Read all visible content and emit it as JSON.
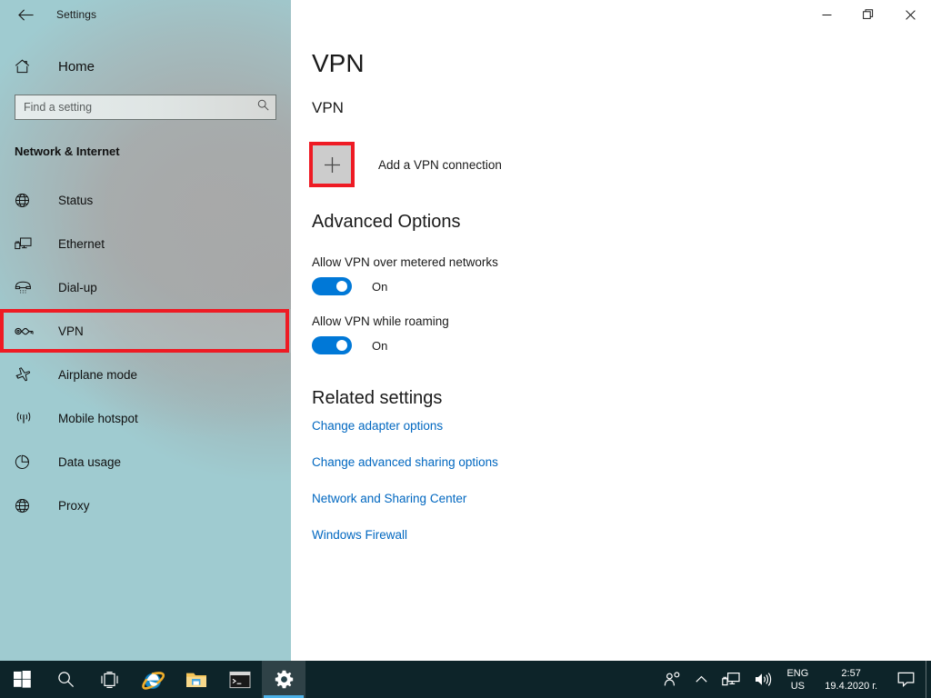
{
  "window": {
    "app_title": "Settings",
    "back_icon": "back-arrow-icon",
    "controls": {
      "minimize": "minimize-icon",
      "maximize": "restore-icon",
      "close": "close-icon"
    }
  },
  "sidebar": {
    "home": {
      "label": "Home",
      "icon": "home-icon"
    },
    "search": {
      "placeholder": "Find a setting",
      "value": "",
      "icon": "search-icon"
    },
    "category": "Network & Internet",
    "selected_index": 3,
    "items": [
      {
        "label": "Status",
        "icon": "status-globe-icon"
      },
      {
        "label": "Ethernet",
        "icon": "ethernet-icon"
      },
      {
        "label": "Dial-up",
        "icon": "dialup-phone-icon"
      },
      {
        "label": "VPN",
        "icon": "vpn-key-icon"
      },
      {
        "label": "Airplane mode",
        "icon": "airplane-icon"
      },
      {
        "label": "Mobile hotspot",
        "icon": "hotspot-icon"
      },
      {
        "label": "Data usage",
        "icon": "pie-chart-icon"
      },
      {
        "label": "Proxy",
        "icon": "globe-icon"
      }
    ]
  },
  "main": {
    "page_title": "VPN",
    "vpn_section": {
      "heading": "VPN",
      "add_button_icon": "plus-icon",
      "add_button_label": "Add a VPN connection"
    },
    "advanced": {
      "heading": "Advanced Options",
      "toggles": [
        {
          "label": "Allow VPN over metered networks",
          "state": "On",
          "on": true
        },
        {
          "label": "Allow VPN while roaming",
          "state": "On",
          "on": true
        }
      ]
    },
    "related": {
      "heading": "Related settings",
      "links": [
        "Change adapter options",
        "Change advanced sharing options",
        "Network and Sharing Center",
        "Windows Firewall"
      ]
    }
  },
  "taskbar": {
    "buttons": [
      {
        "name": "start-button",
        "icon": "windows-logo-icon"
      },
      {
        "name": "search-button",
        "icon": "search-icon"
      },
      {
        "name": "task-view-button",
        "icon": "task-view-icon"
      },
      {
        "name": "internet-explorer-button",
        "icon": "internet-explorer-icon"
      },
      {
        "name": "file-explorer-button",
        "icon": "folder-icon"
      },
      {
        "name": "command-prompt-button",
        "icon": "command-prompt-icon"
      },
      {
        "name": "settings-button",
        "icon": "gear-icon"
      }
    ],
    "tray": {
      "people_icon": "people-icon",
      "chevron_icon": "chevron-up-icon",
      "network_icon": "network-monitor-icon",
      "volume_icon": "speaker-icon",
      "language_line1": "ENG",
      "language_line2": "US",
      "time": "2:57",
      "date": "19.4.2020 г.",
      "action_center_icon": "notification-icon"
    }
  },
  "colors": {
    "accent_blue": "#0078d7",
    "link_blue": "#0067c0",
    "highlight_red": "#ee1b24",
    "sidebar_teal": "#9fcbd0",
    "taskbar": "#0d2429"
  }
}
